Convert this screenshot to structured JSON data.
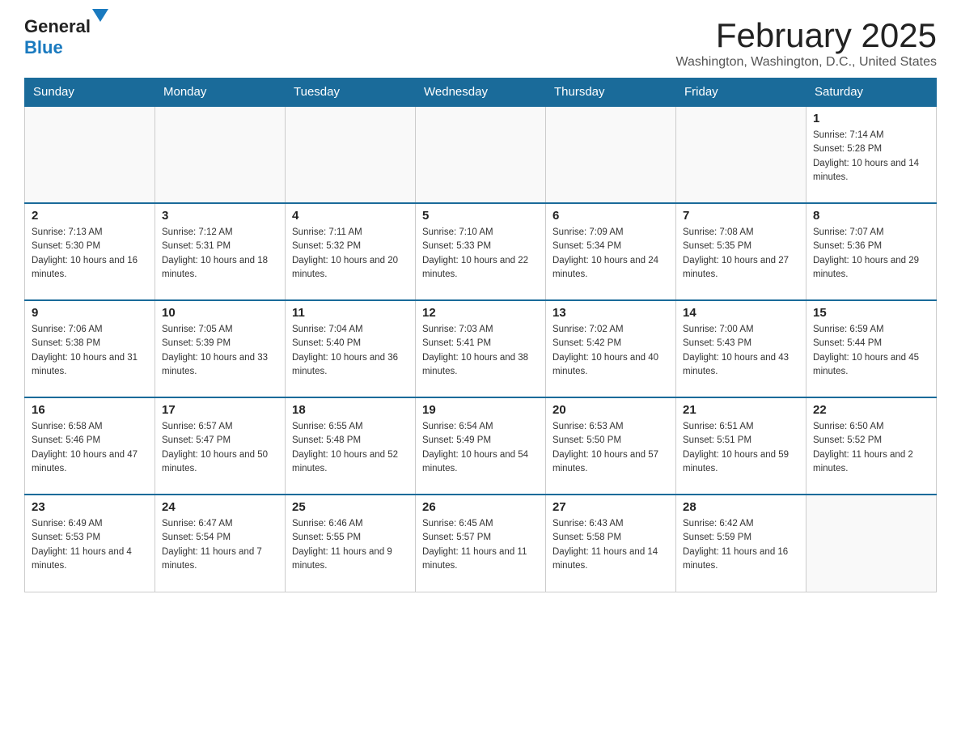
{
  "logo": {
    "general": "General",
    "blue": "Blue"
  },
  "title": "February 2025",
  "location": "Washington, Washington, D.C., United States",
  "weekdays": [
    "Sunday",
    "Monday",
    "Tuesday",
    "Wednesday",
    "Thursday",
    "Friday",
    "Saturday"
  ],
  "weeks": [
    [
      {
        "day": "",
        "sunrise": "",
        "sunset": "",
        "daylight": ""
      },
      {
        "day": "",
        "sunrise": "",
        "sunset": "",
        "daylight": ""
      },
      {
        "day": "",
        "sunrise": "",
        "sunset": "",
        "daylight": ""
      },
      {
        "day": "",
        "sunrise": "",
        "sunset": "",
        "daylight": ""
      },
      {
        "day": "",
        "sunrise": "",
        "sunset": "",
        "daylight": ""
      },
      {
        "day": "",
        "sunrise": "",
        "sunset": "",
        "daylight": ""
      },
      {
        "day": "1",
        "sunrise": "Sunrise: 7:14 AM",
        "sunset": "Sunset: 5:28 PM",
        "daylight": "Daylight: 10 hours and 14 minutes."
      }
    ],
    [
      {
        "day": "2",
        "sunrise": "Sunrise: 7:13 AM",
        "sunset": "Sunset: 5:30 PM",
        "daylight": "Daylight: 10 hours and 16 minutes."
      },
      {
        "day": "3",
        "sunrise": "Sunrise: 7:12 AM",
        "sunset": "Sunset: 5:31 PM",
        "daylight": "Daylight: 10 hours and 18 minutes."
      },
      {
        "day": "4",
        "sunrise": "Sunrise: 7:11 AM",
        "sunset": "Sunset: 5:32 PM",
        "daylight": "Daylight: 10 hours and 20 minutes."
      },
      {
        "day": "5",
        "sunrise": "Sunrise: 7:10 AM",
        "sunset": "Sunset: 5:33 PM",
        "daylight": "Daylight: 10 hours and 22 minutes."
      },
      {
        "day": "6",
        "sunrise": "Sunrise: 7:09 AM",
        "sunset": "Sunset: 5:34 PM",
        "daylight": "Daylight: 10 hours and 24 minutes."
      },
      {
        "day": "7",
        "sunrise": "Sunrise: 7:08 AM",
        "sunset": "Sunset: 5:35 PM",
        "daylight": "Daylight: 10 hours and 27 minutes."
      },
      {
        "day": "8",
        "sunrise": "Sunrise: 7:07 AM",
        "sunset": "Sunset: 5:36 PM",
        "daylight": "Daylight: 10 hours and 29 minutes."
      }
    ],
    [
      {
        "day": "9",
        "sunrise": "Sunrise: 7:06 AM",
        "sunset": "Sunset: 5:38 PM",
        "daylight": "Daylight: 10 hours and 31 minutes."
      },
      {
        "day": "10",
        "sunrise": "Sunrise: 7:05 AM",
        "sunset": "Sunset: 5:39 PM",
        "daylight": "Daylight: 10 hours and 33 minutes."
      },
      {
        "day": "11",
        "sunrise": "Sunrise: 7:04 AM",
        "sunset": "Sunset: 5:40 PM",
        "daylight": "Daylight: 10 hours and 36 minutes."
      },
      {
        "day": "12",
        "sunrise": "Sunrise: 7:03 AM",
        "sunset": "Sunset: 5:41 PM",
        "daylight": "Daylight: 10 hours and 38 minutes."
      },
      {
        "day": "13",
        "sunrise": "Sunrise: 7:02 AM",
        "sunset": "Sunset: 5:42 PM",
        "daylight": "Daylight: 10 hours and 40 minutes."
      },
      {
        "day": "14",
        "sunrise": "Sunrise: 7:00 AM",
        "sunset": "Sunset: 5:43 PM",
        "daylight": "Daylight: 10 hours and 43 minutes."
      },
      {
        "day": "15",
        "sunrise": "Sunrise: 6:59 AM",
        "sunset": "Sunset: 5:44 PM",
        "daylight": "Daylight: 10 hours and 45 minutes."
      }
    ],
    [
      {
        "day": "16",
        "sunrise": "Sunrise: 6:58 AM",
        "sunset": "Sunset: 5:46 PM",
        "daylight": "Daylight: 10 hours and 47 minutes."
      },
      {
        "day": "17",
        "sunrise": "Sunrise: 6:57 AM",
        "sunset": "Sunset: 5:47 PM",
        "daylight": "Daylight: 10 hours and 50 minutes."
      },
      {
        "day": "18",
        "sunrise": "Sunrise: 6:55 AM",
        "sunset": "Sunset: 5:48 PM",
        "daylight": "Daylight: 10 hours and 52 minutes."
      },
      {
        "day": "19",
        "sunrise": "Sunrise: 6:54 AM",
        "sunset": "Sunset: 5:49 PM",
        "daylight": "Daylight: 10 hours and 54 minutes."
      },
      {
        "day": "20",
        "sunrise": "Sunrise: 6:53 AM",
        "sunset": "Sunset: 5:50 PM",
        "daylight": "Daylight: 10 hours and 57 minutes."
      },
      {
        "day": "21",
        "sunrise": "Sunrise: 6:51 AM",
        "sunset": "Sunset: 5:51 PM",
        "daylight": "Daylight: 10 hours and 59 minutes."
      },
      {
        "day": "22",
        "sunrise": "Sunrise: 6:50 AM",
        "sunset": "Sunset: 5:52 PM",
        "daylight": "Daylight: 11 hours and 2 minutes."
      }
    ],
    [
      {
        "day": "23",
        "sunrise": "Sunrise: 6:49 AM",
        "sunset": "Sunset: 5:53 PM",
        "daylight": "Daylight: 11 hours and 4 minutes."
      },
      {
        "day": "24",
        "sunrise": "Sunrise: 6:47 AM",
        "sunset": "Sunset: 5:54 PM",
        "daylight": "Daylight: 11 hours and 7 minutes."
      },
      {
        "day": "25",
        "sunrise": "Sunrise: 6:46 AM",
        "sunset": "Sunset: 5:55 PM",
        "daylight": "Daylight: 11 hours and 9 minutes."
      },
      {
        "day": "26",
        "sunrise": "Sunrise: 6:45 AM",
        "sunset": "Sunset: 5:57 PM",
        "daylight": "Daylight: 11 hours and 11 minutes."
      },
      {
        "day": "27",
        "sunrise": "Sunrise: 6:43 AM",
        "sunset": "Sunset: 5:58 PM",
        "daylight": "Daylight: 11 hours and 14 minutes."
      },
      {
        "day": "28",
        "sunrise": "Sunrise: 6:42 AM",
        "sunset": "Sunset: 5:59 PM",
        "daylight": "Daylight: 11 hours and 16 minutes."
      },
      {
        "day": "",
        "sunrise": "",
        "sunset": "",
        "daylight": ""
      }
    ]
  ]
}
